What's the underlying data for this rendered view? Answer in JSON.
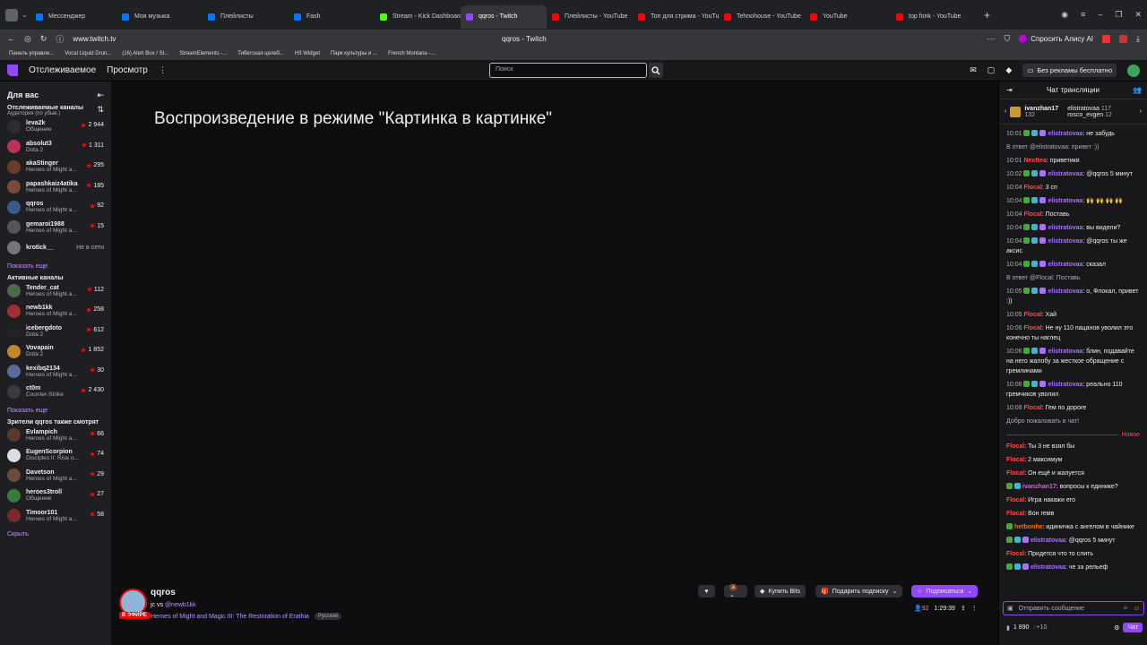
{
  "browser": {
    "tabs": [
      {
        "label": "Мессенджер",
        "color": "#0077ff"
      },
      {
        "label": "Моя музыка",
        "color": "#0077ff"
      },
      {
        "label": "Плейлисты",
        "color": "#0077ff"
      },
      {
        "label": "Fash",
        "color": "#0077ff"
      },
      {
        "label": "Stream - Kick Dashboard",
        "color": "#53fc18"
      },
      {
        "label": "qqros - Twitch",
        "color": "#9146ff"
      },
      {
        "label": "Плейлисты - YouTube",
        "color": "#ff0000"
      },
      {
        "label": "Топ для стрима - YouTube",
        "color": "#ff0000"
      },
      {
        "label": "Tehnohouse - YouTube",
        "color": "#ff0000"
      },
      {
        "label": "YouTube",
        "color": "#ff0000"
      },
      {
        "label": "top fonk - YouTube",
        "color": "#ff0000"
      }
    ],
    "url": "www.twitch.tv",
    "page_title": "qqros - Twitch",
    "alice_label": "Спросить Алису AI",
    "bookmarks": [
      "Панель управле...",
      "Vocal Liquid Drun...",
      "(16) Alert Box / St...",
      "StreamElements -...",
      "Тибетская целеб...",
      "H3 Widget",
      "Парк культуры и ...",
      "French Montana -..."
    ]
  },
  "twitch_nav": {
    "following": "Отслеживаемое",
    "browse": "Просмотр",
    "search_placeholder": "Поиск",
    "ad_free": "Без рекламы бесплатно"
  },
  "sidebar": {
    "title": "Для вас",
    "followed_title": "Отслеживаемые каналы",
    "followed_sub": "Аудитория (по убыв.)",
    "followed": [
      {
        "name": "leva2k",
        "game": "Общение",
        "viewers": "2 944",
        "color": "#2d2d2d"
      },
      {
        "name": "absolut3",
        "game": "Dota 2",
        "viewers": "1 311",
        "color": "#b8325a"
      },
      {
        "name": "akaStinger",
        "game": "Heroes of Might a...",
        "viewers": "295",
        "color": "#6b3a2a"
      },
      {
        "name": "papashkaiz4atika",
        "game": "Heroes of Might a...",
        "viewers": "185",
        "color": "#7a4b3a"
      },
      {
        "name": "qqros",
        "game": "Heroes of Might a...",
        "viewers": "92",
        "color": "#3a5a8a"
      },
      {
        "name": "gemaroi1988",
        "game": "Heroes of Might a...",
        "viewers": "15",
        "color": "#555555"
      },
      {
        "name": "krotick__",
        "game": "",
        "viewers": "Не в сети",
        "color": "#777777"
      }
    ],
    "show_more": "Показать еще",
    "active_title": "Активные каналы",
    "active": [
      {
        "name": "Tender_cat",
        "game": "Heroes of Might a...",
        "viewers": "112",
        "color": "#4a6a4a"
      },
      {
        "name": "newb1kk",
        "game": "Heroes of Might a...",
        "viewers": "258",
        "color": "#a03030"
      },
      {
        "name": "icebergdoto",
        "game": "Dota 2",
        "viewers": "612",
        "color": "#222222"
      },
      {
        "name": "Vovapain",
        "game": "Dota 2",
        "viewers": "1 852",
        "color": "#c0882a"
      },
      {
        "name": "kexibq2134",
        "game": "Heroes of Might a...",
        "viewers": "30",
        "color": "#5a6a9a"
      },
      {
        "name": "ct0m",
        "game": "Counter-Strike",
        "viewers": "2 430",
        "color": "#3a3a3a"
      }
    ],
    "also_title": "Зрители qqros также смотрят",
    "also": [
      {
        "name": "Evlampich",
        "game": "Heroes of Might a...",
        "viewers": "66",
        "color": "#5a3a2a"
      },
      {
        "name": "EugenScorpion",
        "game": "Disciples II: Rise o...",
        "viewers": "74",
        "color": "#dddddd"
      },
      {
        "name": "Davetson",
        "game": "Heroes of Might a...",
        "viewers": "29",
        "color": "#6a4a3a"
      },
      {
        "name": "heroes3troll",
        "game": "Общение",
        "viewers": "27",
        "color": "#3a7a3a"
      },
      {
        "name": "Timoor101",
        "game": "Heroes of Might a...",
        "viewers": "58",
        "color": "#7a2a2a"
      }
    ],
    "hide": "Скрыть"
  },
  "player": {
    "pip_text": "Воспроизведение в режиме \"Картинка в картинке\""
  },
  "stream_info": {
    "channel": "qqros",
    "title_prefix": "jc vs",
    "title_mention": "@newb1kk",
    "game": "Heroes of Might and Magic III: The Restoration of Erathia",
    "tag": "Русский",
    "live": "В ЭФИРЕ",
    "viewers": "92",
    "uptime": "1:29:39",
    "buy_bits": "Купить Bits",
    "gift_sub": "Подарить подписку",
    "subscribe": "Подписаться"
  },
  "chat": {
    "title": "Чат трансляции",
    "gifter": "ivanzhan17",
    "gifter_count": "132",
    "top1": "elistratovaa",
    "top1_count": "117",
    "top2": "rosco_evgen",
    "top2_count": "12",
    "messages": [
      {
        "time": "10:01",
        "user": "elistratovaa",
        "cls": "u-p",
        "badges": 3,
        "text": ": не забудь"
      },
      {
        "time": "",
        "user": "",
        "cls": "",
        "badges": 0,
        "text": "В ответ @elistratovaa: привет :))",
        "reply": true
      },
      {
        "time": "10:01",
        "user": "Nexttea",
        "cls": "u-r",
        "badges": 0,
        "text": ": приветики"
      },
      {
        "time": "10:02",
        "user": "elistratovaa",
        "cls": "u-p",
        "badges": 3,
        "text": ": @qqros 5 минут"
      },
      {
        "time": "10:04",
        "user": "Flocal",
        "cls": "u-r",
        "badges": 0,
        "text": ": 3 сп"
      },
      {
        "time": "10:04",
        "user": "elistratovaa",
        "cls": "u-p",
        "badges": 3,
        "text": ": 🙌 🙌 🙌 🙌"
      },
      {
        "time": "10:04",
        "user": "Flocal",
        "cls": "u-r",
        "badges": 0,
        "text": ": Поставь"
      },
      {
        "time": "10:04",
        "user": "elistratovaa",
        "cls": "u-p",
        "badges": 3,
        "text": ": вы видели?"
      },
      {
        "time": "10:04",
        "user": "elistratovaa",
        "cls": "u-p",
        "badges": 3,
        "text": ": @qqros ты же аксис"
      },
      {
        "time": "10:04",
        "user": "elistratovaa",
        "cls": "u-p",
        "badges": 3,
        "text": ": сказал"
      },
      {
        "time": "",
        "user": "",
        "cls": "",
        "badges": 0,
        "text": "В ответ @Flocal: Поставь",
        "reply": true
      },
      {
        "time": "10:05",
        "user": "elistratovaa",
        "cls": "u-p",
        "badges": 3,
        "text": ": о, Флокал, привет :))"
      },
      {
        "time": "10:05",
        "user": "Flocal",
        "cls": "u-r",
        "badges": 0,
        "text": ": Хай"
      },
      {
        "time": "10:06",
        "user": "Flocal",
        "cls": "u-r",
        "badges": 0,
        "text": ": Не ну 110 пацанов уволил это конечно ты наглец"
      },
      {
        "time": "10:06",
        "user": "elistratovaa",
        "cls": "u-p",
        "badges": 3,
        "text": ": блин, подавайте на него жалобу за жесткое обращение с гремлинами"
      },
      {
        "time": "10:06",
        "user": "elistratovaa",
        "cls": "u-p",
        "badges": 3,
        "text": ": реально 110 гремчиков уволил"
      },
      {
        "time": "10:08",
        "user": "Flocal",
        "cls": "u-r",
        "badges": 0,
        "text": ": Гем по дороге"
      }
    ],
    "welcome": "Добро пожаловать в чат!",
    "new_label": "Новое",
    "new_messages": [
      {
        "user": "Flocal",
        "cls": "u-r",
        "badges": 0,
        "text": ": Ты 3 не взял бы"
      },
      {
        "user": "Flocal",
        "cls": "u-r",
        "badges": 0,
        "text": ": 2 максимум"
      },
      {
        "user": "Flocal",
        "cls": "u-r",
        "badges": 0,
        "text": ": Он ещё и жалуется"
      },
      {
        "user": "ivanzhan17",
        "cls": "u-m",
        "badges": 2,
        "text": ": вопросы к единике?"
      },
      {
        "user": "Flocal",
        "cls": "u-r",
        "badges": 0,
        "text": ": Игра накажи его"
      },
      {
        "user": "Flocal",
        "cls": "u-r",
        "badges": 0,
        "text": ": Вон гемв"
      },
      {
        "user": "hetbonhe",
        "cls": "u-o",
        "badges": 1,
        "text": ": идиничка с ангелом в чайнике"
      },
      {
        "user": "elistratovaa",
        "cls": "u-p",
        "badges": 3,
        "text": ": @qqros 5 минут"
      },
      {
        "user": "Flocal",
        "cls": "u-r",
        "badges": 0,
        "text": ": Придется что то слить"
      },
      {
        "user": "elistratovaa",
        "cls": "u-p",
        "badges": 3,
        "text": ": че за рельеф"
      }
    ],
    "input_placeholder": "Отправить сообщение",
    "points": "1 890",
    "plus": "+10",
    "chat_button": "Чат"
  }
}
